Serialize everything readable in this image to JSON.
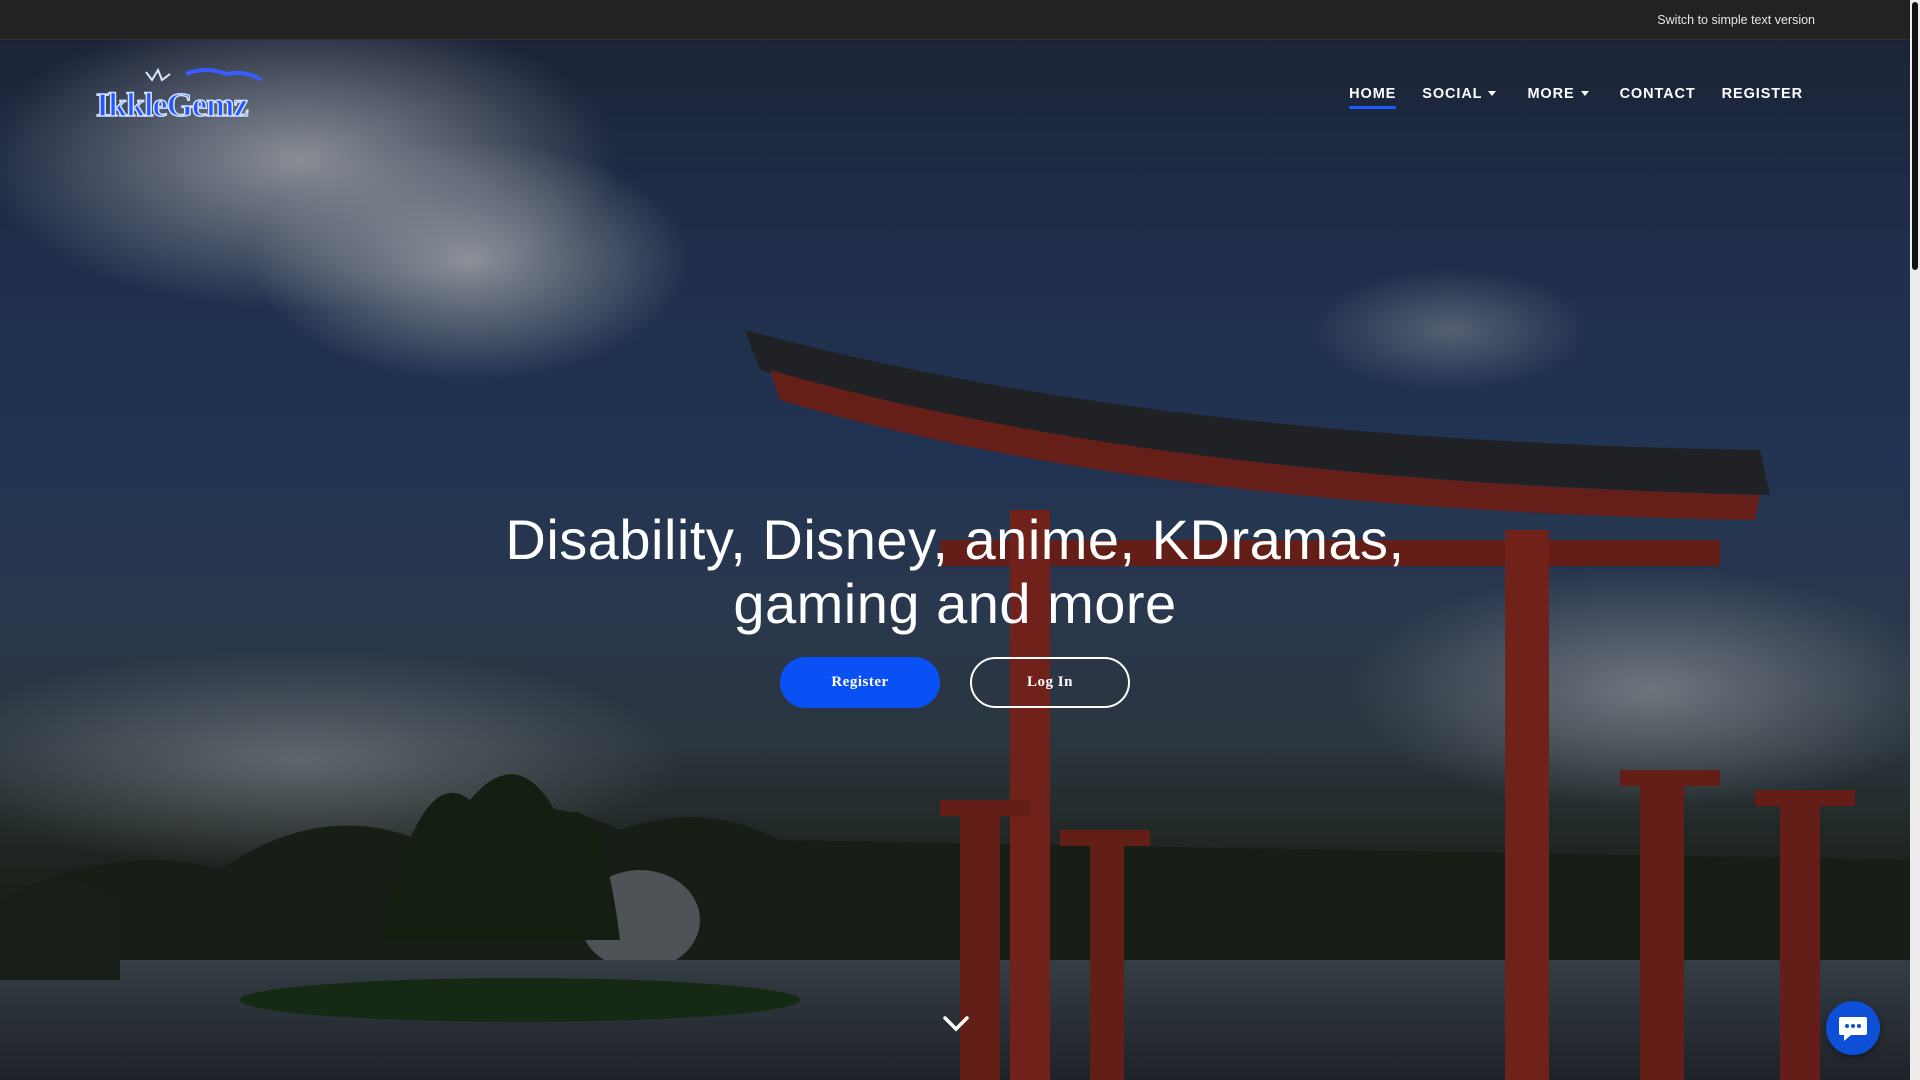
{
  "topbar": {
    "simple_text_link": "Switch to simple text version"
  },
  "logo": {
    "text": "IkkleGemz",
    "icon": "ikklegemz-logo"
  },
  "nav": {
    "home": "HOME",
    "social": "SOCIAL",
    "more": "MORE",
    "contact": "CONTACT",
    "register": "REGISTER",
    "active": "HOME",
    "active_color": "#1a5cff"
  },
  "hero": {
    "headline_line1": "Disability, Disney, anime, KDramas,",
    "headline_line2": "gaming and more",
    "register_button": "Register",
    "login_button": "Log In",
    "scroll_icon": "chevron-down-icon"
  },
  "chat": {
    "icon": "chat-bubble-icon",
    "color": "#0d4fd6"
  },
  "colors": {
    "topbar_bg": "#222222",
    "accent": "#0950f5"
  }
}
